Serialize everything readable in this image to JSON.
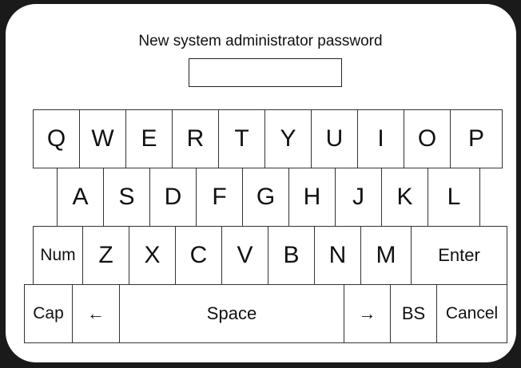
{
  "prompt": {
    "title": "New system administrator password",
    "password_value": ""
  },
  "keyboard": {
    "row1": [
      "Q",
      "W",
      "E",
      "R",
      "T",
      "Y",
      "U",
      "I",
      "O",
      "P"
    ],
    "row2": [
      "A",
      "S",
      "D",
      "F",
      "G",
      "H",
      "J",
      "K",
      "L"
    ],
    "row3": [
      "Num",
      "Z",
      "X",
      "C",
      "V",
      "B",
      "N",
      "M",
      "Enter"
    ],
    "row4": [
      "Cap",
      "←",
      "Space",
      "→",
      "BS",
      "Cancel"
    ]
  },
  "colors": {
    "background": "#1a1a1a",
    "panel": "#ffffff",
    "border": "#333333"
  }
}
